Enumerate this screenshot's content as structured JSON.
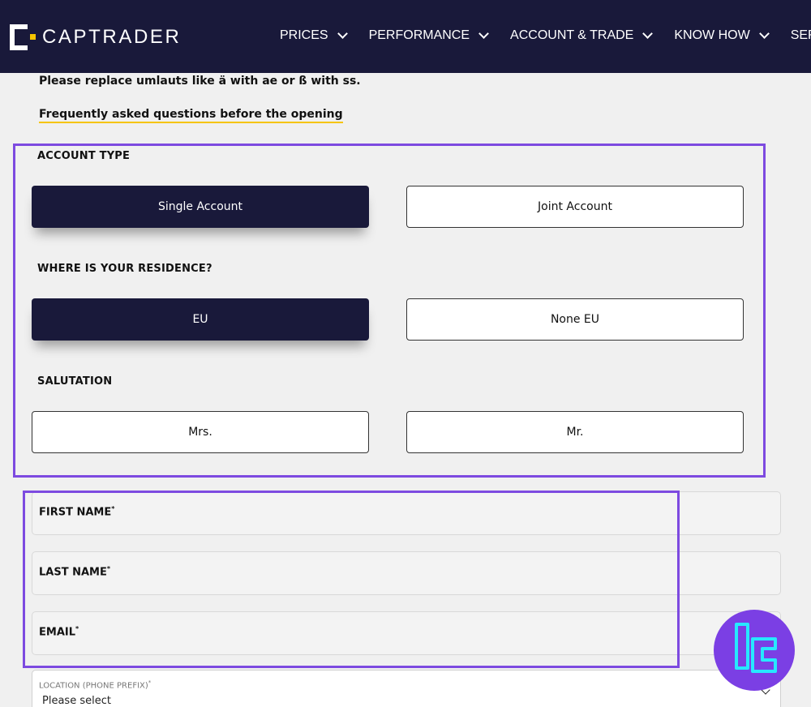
{
  "brand": {
    "name": "CAPTRADER",
    "colors": {
      "navy": "#19193a",
      "accent": "#f5c400",
      "highlight": "#7d4ae0",
      "badge": "#7b3fe4",
      "badge_logo": "#27e8ff"
    }
  },
  "nav": {
    "items": [
      {
        "label": "PRICES",
        "has_dropdown": true
      },
      {
        "label": "PERFORMANCE",
        "has_dropdown": true
      },
      {
        "label": "ACCOUNT & TRADE",
        "has_dropdown": true
      },
      {
        "label": "KNOW HOW",
        "has_dropdown": true
      },
      {
        "label": "SERVICE",
        "has_dropdown": false
      }
    ]
  },
  "form": {
    "note": "Please replace umlauts like ä with ae or ß with ss.",
    "faq_link": "Frequently asked questions before the opening",
    "account_type": {
      "label": "ACCOUNT TYPE",
      "options": [
        "Single Account",
        "Joint Account"
      ],
      "selected": "Single Account"
    },
    "residence": {
      "label": "WHERE IS YOUR RESIDENCE?",
      "options": [
        "EU",
        "None EU"
      ],
      "selected": "EU"
    },
    "salutation": {
      "label": "SALUTATION",
      "options": [
        "Mrs.",
        "Mr."
      ],
      "selected": null
    },
    "fields": [
      {
        "label": "FIRST NAME",
        "required_mark": "*",
        "value": ""
      },
      {
        "label": "LAST NAME",
        "required_mark": "*",
        "value": ""
      },
      {
        "label": "EMAIL",
        "required_mark": "*",
        "value": ""
      }
    ],
    "location": {
      "label": "LOCATION (PHONE PREFIX)",
      "required_mark": "*",
      "value": "Please select"
    }
  },
  "icons": {
    "nav_dropdown": "chevron-down-icon",
    "select": "chevron-down-icon",
    "watermark": "tc-logo-icon"
  }
}
